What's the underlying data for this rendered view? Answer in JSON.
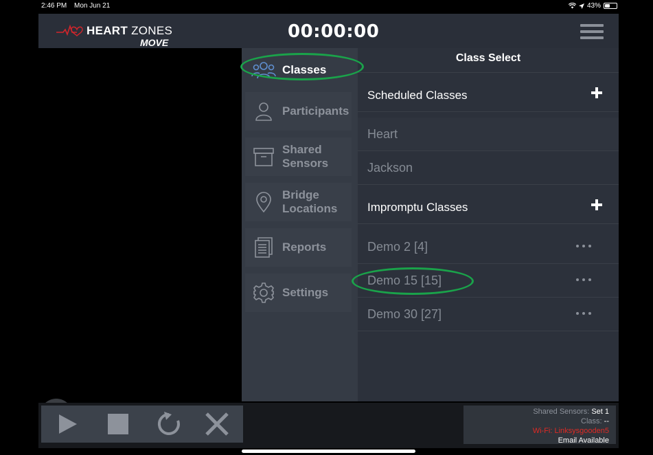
{
  "status_bar": {
    "time": "2:46 PM",
    "date": "Mon Jun 21",
    "battery": "43%",
    "battery_level": 0.43
  },
  "header": {
    "logo_heart": "HEART",
    "logo_zones": "ZONES",
    "logo_move": "MOVE",
    "timer": "00:00:00",
    "menu_icon": "hamburger-menu-icon"
  },
  "sidebar": {
    "items": [
      {
        "label": "Classes",
        "icon": "people-group-icon",
        "active": true
      },
      {
        "label": "Participants",
        "icon": "person-icon",
        "active": false
      },
      {
        "label": "Shared Sensors",
        "icon": "archive-box-icon",
        "active": false
      },
      {
        "label": "Bridge Locations",
        "icon": "map-pin-icon",
        "active": false
      },
      {
        "label": "Reports",
        "icon": "document-icon",
        "active": false
      },
      {
        "label": "Settings",
        "icon": "gear-icon",
        "active": false
      }
    ]
  },
  "class_select": {
    "title": "Class Select",
    "scheduled_header": "Scheduled Classes",
    "scheduled": [
      "Heart",
      "Jackson"
    ],
    "impromptu_header": "Impromptu Classes",
    "impromptu": [
      "Demo 2 [4]",
      "Demo 15 [15]",
      "Demo 30 [27]"
    ]
  },
  "bottom": {
    "shared_sensors_key": "Shared Sensors:",
    "shared_sensors_value": "Set 1",
    "class_key": "Class:",
    "class_value": "--",
    "wifi": "Wi-Fi: Linksysgooden5",
    "email": "Email Available"
  },
  "colors": {
    "header_bg": "#2a2f39",
    "annotation": "#1aa34a",
    "wifi_text": "#e02a24"
  }
}
